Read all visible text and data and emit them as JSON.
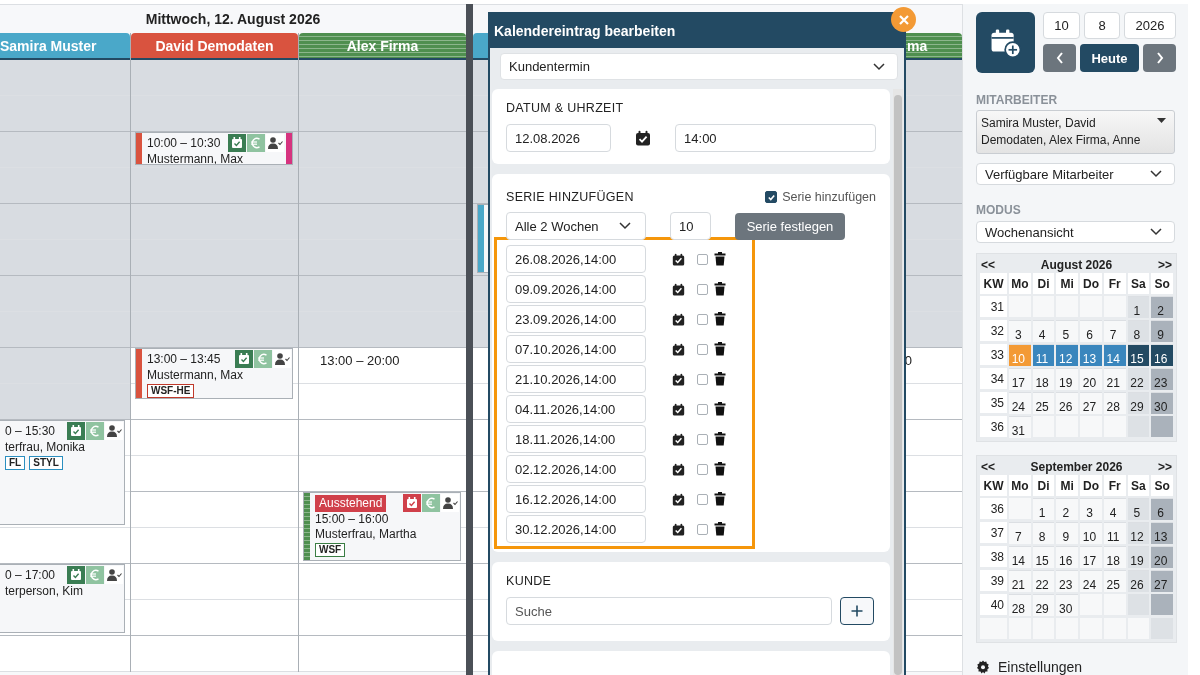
{
  "day_view": {
    "title": "Mittwoch, 12. August 2026",
    "columns": [
      {
        "name": "Samira Muster",
        "color": "#4aa8c9",
        "striped": false,
        "slots": [
          {
            "available": false
          },
          {
            "available": false
          },
          {
            "available": false
          },
          {
            "available": false
          },
          {
            "available": false
          },
          {
            "available": false
          },
          {
            "available": false
          },
          {
            "available": false
          },
          {
            "available": false
          },
          {
            "available": false
          },
          {
            "available": true,
            "event": {
              "time": "0 – 15:30",
              "name": "terfrau, Monika",
              "confirmed": true,
              "tags": [
                {
                  "label": "FL",
                  "color": "#2b8fc0"
                },
                {
                  "label": "STYL",
                  "color": "#2b8fc0"
                }
              ]
            }
          },
          {
            "available": true
          },
          {
            "available": true,
            "event": {
              "time": "0 – 17:00",
              "name": "terperson, Kim",
              "confirmed": true
            }
          },
          {
            "available": true
          }
        ]
      },
      {
        "name": "David Demodaten",
        "color": "#d9533f",
        "striped": false,
        "slots": [
          {
            "available": false
          },
          {
            "available": false
          },
          {
            "available": false,
            "event": {
              "time": "10:00 – 10:30",
              "name": "Mustermann, Max",
              "confirmed": true,
              "color": "#d6337f"
            }
          },
          {
            "available": false
          },
          {
            "available": false
          },
          {
            "available": false
          },
          {
            "available": false
          },
          {
            "available": false
          },
          {
            "available": true,
            "event": {
              "time": "13:00 – 13:45",
              "name": "Mustermann, Max",
              "confirmed": true,
              "tags": [
                {
                  "label": "WSF-HE",
                  "color": "#c0392b"
                }
              ]
            }
          },
          {
            "available": true
          },
          {
            "available": true
          },
          {
            "available": true
          },
          {
            "available": true
          },
          {
            "available": true
          },
          {
            "available": true
          },
          {
            "available": true
          }
        ]
      },
      {
        "name": "Alex Firma",
        "color": "#4f8f4f",
        "striped": true,
        "slots": [
          {
            "available": false
          },
          {
            "available": false
          },
          {
            "available": false
          },
          {
            "available": false
          },
          {
            "available": false
          },
          {
            "available": false
          },
          {
            "available": false
          },
          {
            "available": false
          },
          {
            "available": true,
            "note": "13:00 – 20:00"
          },
          {
            "available": true
          },
          {
            "available": true
          },
          {
            "available": true
          },
          {
            "available": true,
            "event": {
              "status": "Ausstehend",
              "time": "15:00 – 16:00",
              "name": "Musterfrau, Martha",
              "confirmed": false,
              "tags": [
                {
                  "label": "WSF",
                  "color": "#3a7d44"
                }
              ]
            }
          },
          {
            "available": true
          },
          {
            "available": true
          },
          {
            "available": true
          }
        ]
      }
    ]
  },
  "next_day": {
    "columns": [
      {
        "color": "#4aa8c9",
        "striped": false,
        "slots": [
          {
            "available": false
          },
          {
            "available": false
          },
          {
            "available": false
          },
          {
            "available": false
          },
          {
            "available": false,
            "event": {
              "color": "#4aa8c9"
            }
          },
          {
            "available": false
          },
          {
            "available": false
          },
          {
            "available": true
          },
          {
            "available": true
          },
          {
            "available": true
          },
          {
            "available": true
          },
          {
            "available": true
          },
          {
            "available": true
          },
          {
            "available": true
          },
          {
            "available": true
          },
          {
            "available": true
          }
        ]
      },
      {
        "name": "ma",
        "color": "#4f8f4f",
        "striped": true,
        "slots": [
          {
            "available": false
          },
          {
            "available": false
          },
          {
            "available": false
          },
          {
            "available": false
          },
          {
            "available": false
          },
          {
            "available": false
          },
          {
            "available": false
          },
          {
            "available": false
          },
          {
            "available": true,
            "note": "0"
          },
          {
            "available": true
          },
          {
            "available": true
          },
          {
            "available": true
          },
          {
            "available": true
          },
          {
            "available": true
          },
          {
            "available": true
          },
          {
            "available": true
          },
          {
            "available": true
          }
        ]
      }
    ]
  },
  "dialog": {
    "title": "Kalendereintrag bearbeiten",
    "type_select": "Kundentermin",
    "date_section": {
      "label": "DATUM & UHRZEIT",
      "date": "12.08.2026",
      "time": "14:00"
    },
    "series_section": {
      "label": "SERIE HINZUFÜGEN",
      "toggle_label": "Serie hinzufügen",
      "toggle_checked": true,
      "interval": "Alle 2 Wochen",
      "count": "10",
      "apply_button": "Serie festlegen",
      "dates": [
        {
          "value": "26.08.2026,14:00",
          "checked": false
        },
        {
          "value": "09.09.2026,14:00",
          "checked": false
        },
        {
          "value": "23.09.2026,14:00",
          "checked": false
        },
        {
          "value": "07.10.2026,14:00",
          "checked": false
        },
        {
          "value": "21.10.2026,14:00",
          "checked": false
        },
        {
          "value": "04.11.2026,14:00",
          "checked": false
        },
        {
          "value": "18.11.2026,14:00",
          "checked": false
        },
        {
          "value": "02.12.2026,14:00",
          "checked": false
        },
        {
          "value": "16.12.2026,14:00",
          "checked": false
        },
        {
          "value": "30.12.2026,14:00",
          "checked": false
        }
      ]
    },
    "customer_section": {
      "label": "KUNDE",
      "search_placeholder": "Suche"
    }
  },
  "sidebar": {
    "date_fields": [
      "10",
      "8",
      "2026"
    ],
    "today_button": "Heute",
    "employees_label": "MITARBEITER",
    "employees_value": "Samira Muster, David Demodaten, Alex Firma, Anne",
    "availability_select": "Verfügbare Mitarbeiter",
    "mode_label": "MODUS",
    "mode_select": "Wochenansicht",
    "mini_calendars": [
      {
        "title": "August 2026",
        "prev": "<<",
        "next": ">>",
        "headers": [
          "KW",
          "Mo",
          "Di",
          "Mi",
          "Do",
          "Fr",
          "Sa",
          "So"
        ],
        "weeks": [
          {
            "kw": "31",
            "selected": false,
            "days": [
              {
                "kind": "blank"
              },
              {
                "kind": "blank"
              },
              {
                "kind": "blank"
              },
              {
                "kind": "blank"
              },
              {
                "kind": "blank"
              },
              {
                "kind": "day",
                "d": "1",
                "today": false
              },
              {
                "kind": "day",
                "d": "2",
                "today": false
              }
            ]
          },
          {
            "kw": "32",
            "selected": false,
            "days": [
              {
                "kind": "day",
                "d": "3",
                "today": false
              },
              {
                "kind": "day",
                "d": "4",
                "today": false
              },
              {
                "kind": "day",
                "d": "5",
                "today": false
              },
              {
                "kind": "day",
                "d": "6",
                "today": false
              },
              {
                "kind": "day",
                "d": "7",
                "today": false
              },
              {
                "kind": "day",
                "d": "8",
                "today": false
              },
              {
                "kind": "day",
                "d": "9",
                "today": false
              }
            ]
          },
          {
            "kw": "33",
            "selected": true,
            "days": [
              {
                "kind": "day",
                "d": "10",
                "today": true
              },
              {
                "kind": "day",
                "d": "11",
                "today": false
              },
              {
                "kind": "day",
                "d": "12",
                "today": false
              },
              {
                "kind": "day",
                "d": "13",
                "today": false
              },
              {
                "kind": "day",
                "d": "14",
                "today": false
              },
              {
                "kind": "day",
                "d": "15",
                "today": false
              },
              {
                "kind": "day",
                "d": "16",
                "today": false
              }
            ]
          },
          {
            "kw": "34",
            "selected": false,
            "days": [
              {
                "kind": "day",
                "d": "17",
                "today": false
              },
              {
                "kind": "day",
                "d": "18",
                "today": false
              },
              {
                "kind": "day",
                "d": "19",
                "today": false
              },
              {
                "kind": "day",
                "d": "20",
                "today": false
              },
              {
                "kind": "day",
                "d": "21",
                "today": false
              },
              {
                "kind": "day",
                "d": "22",
                "today": false
              },
              {
                "kind": "day",
                "d": "23",
                "today": false
              }
            ]
          },
          {
            "kw": "35",
            "selected": false,
            "days": [
              {
                "kind": "day",
                "d": "24",
                "today": false
              },
              {
                "kind": "day",
                "d": "25",
                "today": false
              },
              {
                "kind": "day",
                "d": "26",
                "today": false
              },
              {
                "kind": "day",
                "d": "27",
                "today": false
              },
              {
                "kind": "day",
                "d": "28",
                "today": false
              },
              {
                "kind": "day",
                "d": "29",
                "today": false
              },
              {
                "kind": "day",
                "d": "30",
                "today": false
              }
            ]
          },
          {
            "kw": "36",
            "selected": false,
            "days": [
              {
                "kind": "day",
                "d": "31",
                "today": false
              },
              {
                "kind": "blank"
              },
              {
                "kind": "blank"
              },
              {
                "kind": "blank"
              },
              {
                "kind": "blank"
              },
              {
                "kind": "blank"
              },
              {
                "kind": "blank"
              }
            ]
          }
        ]
      },
      {
        "title": "September 2026",
        "prev": "<<",
        "next": ">>",
        "headers": [
          "KW",
          "Mo",
          "Di",
          "Mi",
          "Do",
          "Fr",
          "Sa",
          "So"
        ],
        "weeks": [
          {
            "kw": "36",
            "selected": false,
            "days": [
              {
                "kind": "blank"
              },
              {
                "kind": "day",
                "d": "1",
                "today": false
              },
              {
                "kind": "day",
                "d": "2",
                "today": false
              },
              {
                "kind": "day",
                "d": "3",
                "today": false
              },
              {
                "kind": "day",
                "d": "4",
                "today": false
              },
              {
                "kind": "day",
                "d": "5",
                "today": false
              },
              {
                "kind": "day",
                "d": "6",
                "today": false
              }
            ]
          },
          {
            "kw": "37",
            "selected": false,
            "days": [
              {
                "kind": "day",
                "d": "7",
                "today": false
              },
              {
                "kind": "day",
                "d": "8",
                "today": false
              },
              {
                "kind": "day",
                "d": "9",
                "today": false
              },
              {
                "kind": "day",
                "d": "10",
                "today": false
              },
              {
                "kind": "day",
                "d": "11",
                "today": false
              },
              {
                "kind": "day",
                "d": "12",
                "today": false
              },
              {
                "kind": "day",
                "d": "13",
                "today": false
              }
            ]
          },
          {
            "kw": "38",
            "selected": false,
            "days": [
              {
                "kind": "day",
                "d": "14",
                "today": false
              },
              {
                "kind": "day",
                "d": "15",
                "today": false
              },
              {
                "kind": "day",
                "d": "16",
                "today": false
              },
              {
                "kind": "day",
                "d": "17",
                "today": false
              },
              {
                "kind": "day",
                "d": "18",
                "today": false
              },
              {
                "kind": "day",
                "d": "19",
                "today": false
              },
              {
                "kind": "day",
                "d": "20",
                "today": false
              }
            ]
          },
          {
            "kw": "39",
            "selected": false,
            "days": [
              {
                "kind": "day",
                "d": "21",
                "today": false
              },
              {
                "kind": "day",
                "d": "22",
                "today": false
              },
              {
                "kind": "day",
                "d": "23",
                "today": false
              },
              {
                "kind": "day",
                "d": "24",
                "today": false
              },
              {
                "kind": "day",
                "d": "25",
                "today": false
              },
              {
                "kind": "day",
                "d": "26",
                "today": false
              },
              {
                "kind": "day",
                "d": "27",
                "today": false
              }
            ]
          },
          {
            "kw": "40",
            "selected": false,
            "days": [
              {
                "kind": "day",
                "d": "28",
                "today": false
              },
              {
                "kind": "day",
                "d": "29",
                "today": false
              },
              {
                "kind": "day",
                "d": "30",
                "today": false
              },
              {
                "kind": "blank"
              },
              {
                "kind": "blank"
              },
              {
                "kind": "blank"
              },
              {
                "kind": "blank"
              }
            ]
          }
        ]
      }
    ],
    "settings": "Einstellungen"
  }
}
